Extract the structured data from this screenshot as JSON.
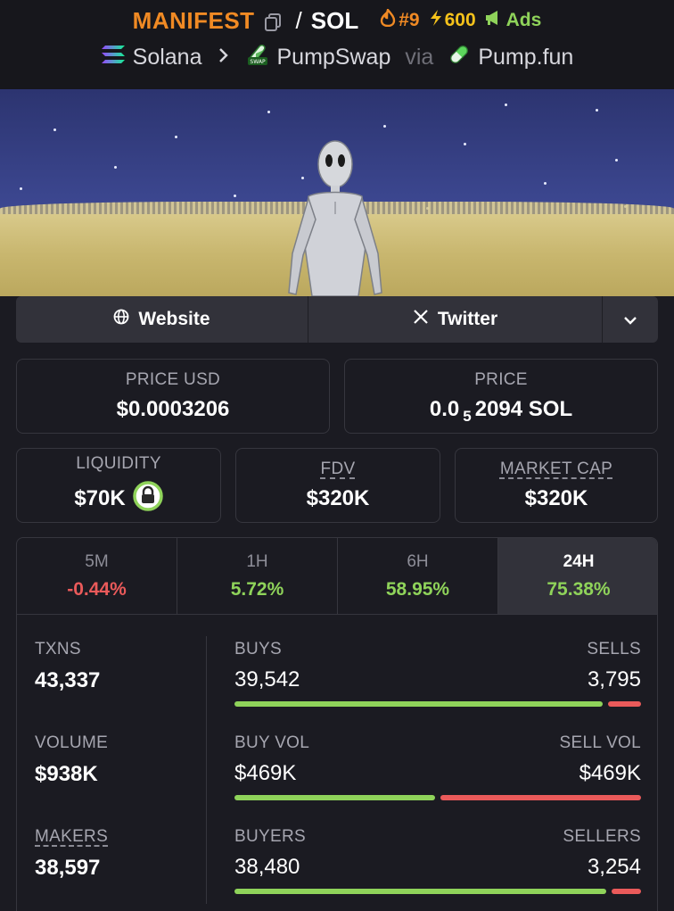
{
  "header": {
    "token_symbol": "MANIFEST",
    "separator": "/",
    "quote_symbol": "SOL",
    "rank": "#9",
    "boosts": "600",
    "ads_label": "Ads",
    "chain": "Solana",
    "dex": "PumpSwap",
    "via_label": "via",
    "launchpad": "Pump.fun",
    "icons": {
      "copy": "copy-icon",
      "rank": "flame-icon",
      "boost": "lightning-icon",
      "ads": "megaphone-icon",
      "chain": "solana-icon",
      "dex": "pumpswap-icon",
      "launchpad": "pill-icon",
      "crumb_separator": "chevron-right-icon"
    }
  },
  "banner": {
    "description_icon": "alien-figure-in-field-icon"
  },
  "links": {
    "website_label": "Website",
    "twitter_label": "Twitter",
    "more_icon": "chevron-down-icon"
  },
  "prices": {
    "price_usd_label": "PRICE USD",
    "price_usd_value": "$0.0003206",
    "price_label": "PRICE",
    "price_prefix": "0.0",
    "price_subscript": "5",
    "price_suffix": "2094 SOL"
  },
  "metrics": {
    "liquidity_label": "LIQUIDITY",
    "liquidity_value": "$70K",
    "fdv_label": "FDV",
    "fdv_value": "$320K",
    "mcap_label": "MARKET CAP",
    "mcap_value": "$320K"
  },
  "timeframes": [
    {
      "label": "5M",
      "change": "-0.44%",
      "trend": "negative"
    },
    {
      "label": "1H",
      "change": "5.72%",
      "trend": "positive"
    },
    {
      "label": "6H",
      "change": "58.95%",
      "trend": "positive"
    },
    {
      "label": "24H",
      "change": "75.38%",
      "trend": "positive",
      "active": true
    }
  ],
  "stats": {
    "txns_label": "TXNS",
    "txns_value": "43,337",
    "volume_label": "VOLUME",
    "volume_value": "$938K",
    "makers_label": "MAKERS",
    "makers_value": "38,597",
    "buys_label": "BUYS",
    "buys_value": "39,542",
    "sells_label": "SELLS",
    "sells_value": "3,795",
    "buys_share": 0.912,
    "buyvol_label": "BUY VOL",
    "buyvol_value": "$469K",
    "sellvol_label": "SELL VOL",
    "sellvol_value": "$469K",
    "buyvol_share": 0.5,
    "buyers_label": "BUYERS",
    "buyers_value": "38,480",
    "sellers_label": "SELLERS",
    "sellers_value": "3,254",
    "buyers_share": 0.922
  },
  "colors": {
    "token": "#f08a24",
    "positive": "#8fd35a",
    "negative": "#ea5a5a",
    "boost": "#f5c21b"
  }
}
